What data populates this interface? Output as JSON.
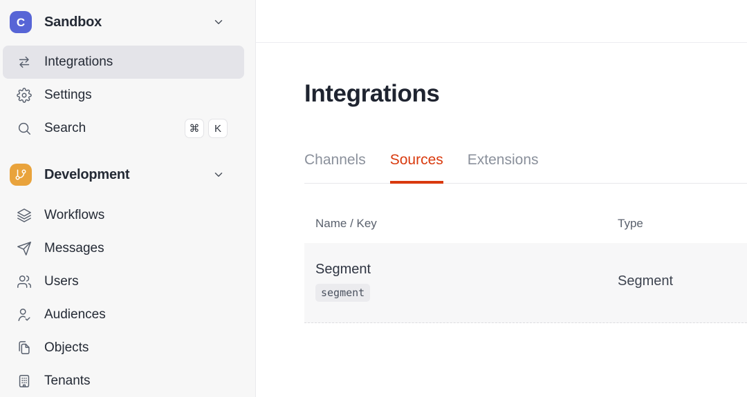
{
  "colors": {
    "accent_red": "#D93A0E",
    "logo_indigo": "#5765D6",
    "development_orange": "#E9A33C",
    "active_item_bg": "#E4E4E9",
    "sidebar_bg": "#F7F7F7"
  },
  "sidebar": {
    "workspace": {
      "name": "Sandbox",
      "initial": "C"
    },
    "items": [
      {
        "label": "Integrations",
        "active": true
      },
      {
        "label": "Settings",
        "active": false
      },
      {
        "label": "Search",
        "active": false
      }
    ],
    "search_shortcut": {
      "meta": "⌘",
      "key": "K"
    },
    "development": {
      "label": "Development"
    },
    "development_items": [
      {
        "label": "Workflows"
      },
      {
        "label": "Messages"
      },
      {
        "label": "Users"
      },
      {
        "label": "Audiences"
      },
      {
        "label": "Objects"
      },
      {
        "label": "Tenants"
      }
    ]
  },
  "main": {
    "title": "Integrations",
    "tabs": [
      {
        "label": "Channels",
        "active": false
      },
      {
        "label": "Sources",
        "active": true
      },
      {
        "label": "Extensions",
        "active": false
      }
    ],
    "table": {
      "columns": [
        "Name / Key",
        "Type"
      ],
      "rows": [
        {
          "name": "Segment",
          "key": "segment",
          "type": "Segment"
        }
      ]
    }
  }
}
